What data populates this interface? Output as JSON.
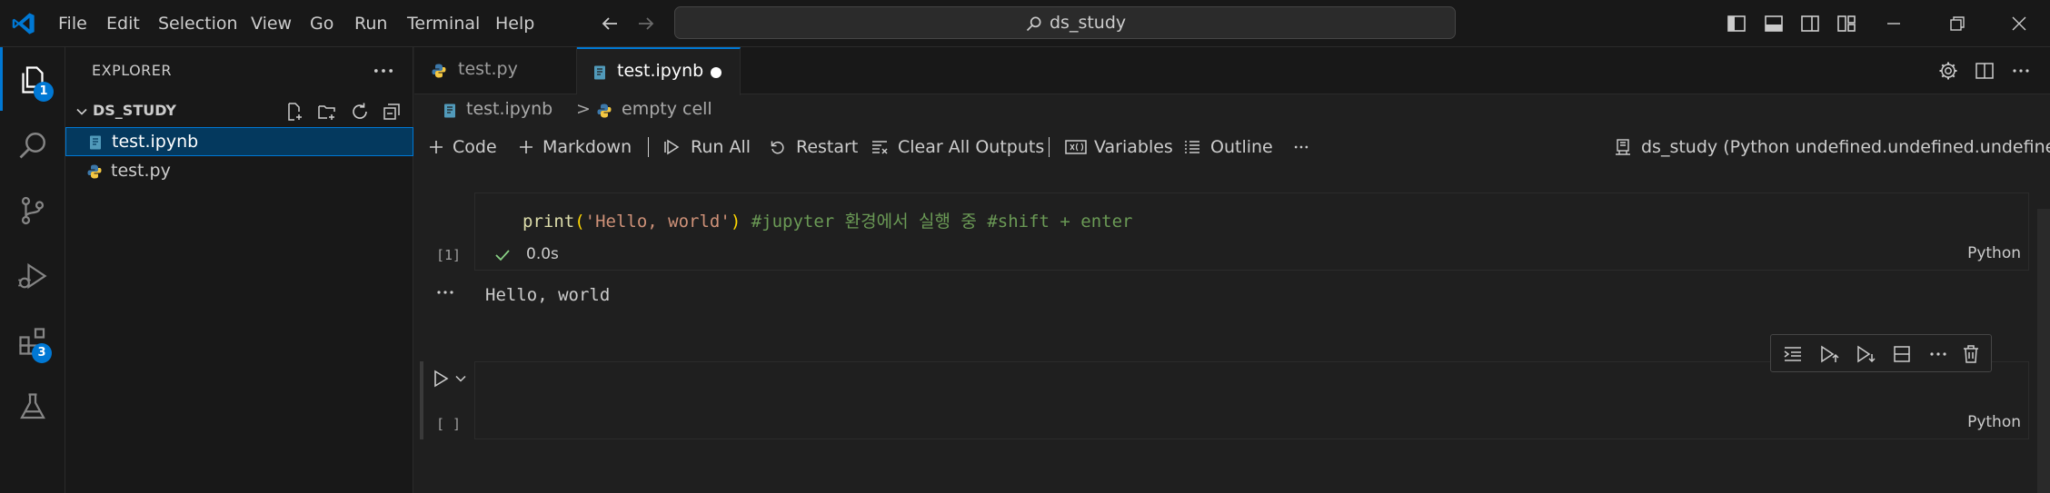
{
  "titlebar": {
    "menus": [
      "File",
      "Edit",
      "Selection",
      "View",
      "Go",
      "Run",
      "Terminal",
      "Help"
    ],
    "search_text": "ds_study",
    "icons": [
      "vscode-logo",
      "back-arrow",
      "forward-arrow",
      "search-icon",
      "toggle-primary-sidebar",
      "toggle-panel",
      "toggle-secondary-sidebar",
      "customize-layout",
      "minimize",
      "restore",
      "close"
    ]
  },
  "activitybar": {
    "items": [
      {
        "name": "explorer",
        "badge": "1"
      },
      {
        "name": "search",
        "badge": ""
      },
      {
        "name": "source-control",
        "badge": ""
      },
      {
        "name": "run-and-debug",
        "badge": ""
      },
      {
        "name": "extensions",
        "badge": "3"
      },
      {
        "name": "testing",
        "badge": ""
      }
    ]
  },
  "sidebar": {
    "title": "EXPLORER",
    "folder": "DS_STUDY",
    "files": [
      {
        "name": "test.ipynb",
        "selected": true
      },
      {
        "name": "test.py",
        "selected": false
      }
    ]
  },
  "tabs": [
    {
      "label": "test.py",
      "active": false
    },
    {
      "label": "test.ipynb",
      "active": true
    }
  ],
  "breadcrumb": {
    "file": "test.ipynb",
    "separator": ">",
    "item": "empty cell"
  },
  "notebook_toolbar": {
    "code": "Code",
    "markdown": "Markdown",
    "run_all": "Run All",
    "restart": "Restart",
    "clear_outputs": "Clear All Outputs",
    "variables": "Variables",
    "outline": "Outline",
    "kernel": "ds_study (Python undefined.undefined.undefined)"
  },
  "cells": [
    {
      "exec_count": "[1]",
      "code_fn": "print",
      "code_paren_open": "(",
      "code_string": "'Hello, world'",
      "code_paren_close": ")",
      "code_comment": " #jupyter 환경에서 실행 중 #shift + enter",
      "status_time": "0.0s",
      "language": "Python",
      "output": "Hello, world"
    },
    {
      "exec_count": "[ ]",
      "language": "Python"
    }
  ],
  "colors": {
    "accent": "#0078d4",
    "selection": "#04395e",
    "success": "#89d185",
    "code_fn": "#dcdcaa",
    "code_string": "#ce9178",
    "code_comment": "#6a9955",
    "code_paren": "#ffd700"
  }
}
